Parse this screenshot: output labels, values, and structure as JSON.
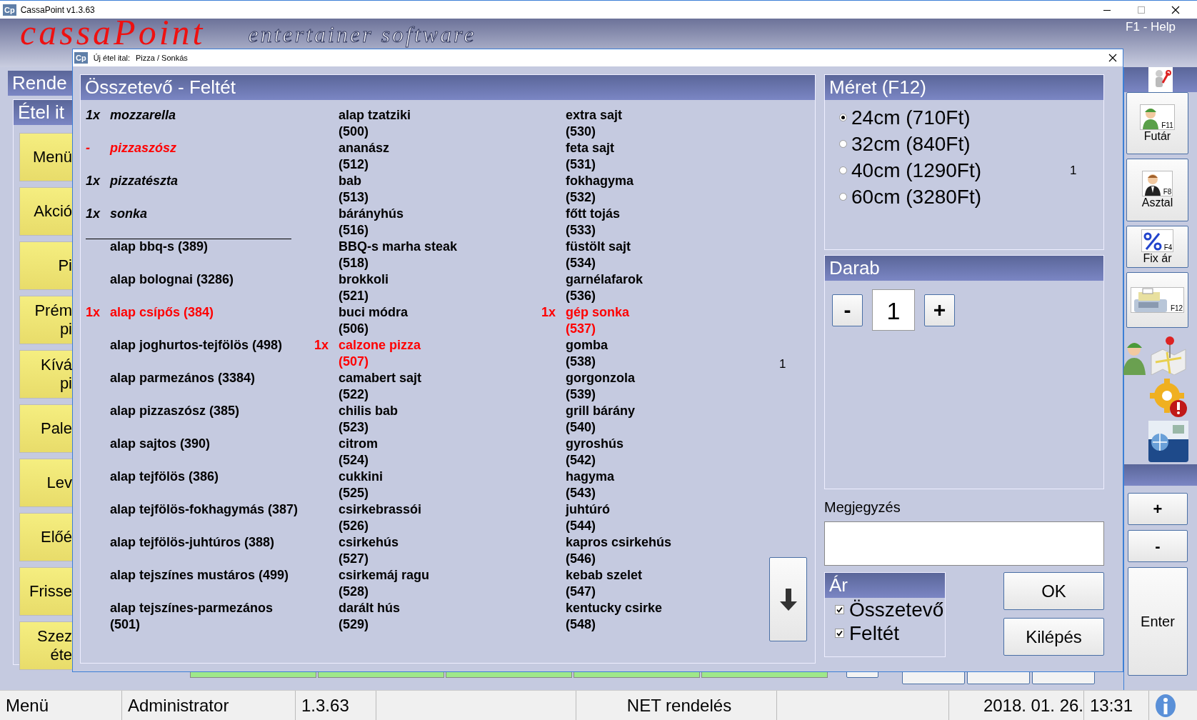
{
  "app_window": {
    "icon": "Cp",
    "title": "CassaPoint v1.3.63"
  },
  "banner": {
    "logo": "cassaPoint",
    "tagline": "entertainer software",
    "help": "F1 - Help"
  },
  "left_panel": {
    "title": "Rende",
    "subtitle": "Étel it",
    "categories": [
      "Menü",
      "Akció",
      "Pi",
      "Prém pi",
      "Kívá pi",
      "Pale",
      "Lev",
      "Előé",
      "Frisse",
      "Szez éte"
    ]
  },
  "side_toolbar": {
    "buttons": [
      {
        "kind": "courier",
        "label": "Futár",
        "key": "F11"
      },
      {
        "kind": "waiter",
        "label": "Asztal",
        "key": "F8"
      },
      {
        "kind": "percent",
        "label": "Fix ár",
        "key": "F4"
      },
      {
        "kind": "register",
        "key": "F12"
      }
    ],
    "keys": [
      "+",
      "-",
      "Enter"
    ]
  },
  "dialog": {
    "icon": "Cp",
    "title": "Új étel ital:",
    "item": "Pizza / Sonkás",
    "ingredients": {
      "title": "Összetevő - Feltét",
      "note": "1",
      "columns": [
        {
          "kind": "wide",
          "items": [
            {
              "kind": "base",
              "qty": "1x",
              "name": "mozzarella",
              "changed": false
            },
            {
              "kind": "base",
              "qty": "-",
              "name": "pizzaszósz",
              "changed": true
            },
            {
              "kind": "base",
              "qty": "1x",
              "name": "pizzatészta",
              "changed": false
            },
            {
              "kind": "base",
              "qty": "1x",
              "name": "sonka",
              "changed": false
            },
            {
              "kind": "topping",
              "name": "alap bbq-s",
              "code": "(389)",
              "changed": false
            },
            {
              "kind": "topping",
              "name": "alap bolognai",
              "code": "(3286)",
              "changed": false
            },
            {
              "kind": "topping",
              "qty": "1x",
              "name": "alap csípős",
              "code": "(384)",
              "changed": true
            },
            {
              "kind": "topping",
              "name": "alap joghurtos-tejfölös",
              "code": "(498)",
              "changed": false
            },
            {
              "kind": "topping",
              "name": "alap parmezános",
              "code": "(3384)",
              "changed": false
            },
            {
              "kind": "topping",
              "name": "alap pizzaszósz",
              "code": "(385)",
              "changed": false
            },
            {
              "kind": "topping",
              "name": "alap sajtos",
              "code": "(390)",
              "changed": false
            },
            {
              "kind": "topping",
              "name": "alap tejfölös",
              "code": "(386)",
              "changed": false
            },
            {
              "kind": "topping",
              "name": "alap tejfölös-fokhagymás",
              "code": "(387)",
              "changed": false
            },
            {
              "kind": "topping",
              "name": "alap tejfölös-juhtúros",
              "code": "(388)",
              "changed": false
            },
            {
              "kind": "topping",
              "name": "alap tejszínes mustáros",
              "code": "(499)",
              "changed": false
            },
            {
              "kind": "topping",
              "name": "alap tejszínes-parmezános",
              "code": "(501)",
              "changed": false
            }
          ]
        },
        {
          "kind": "narrow",
          "items": [
            {
              "kind": "topping",
              "name": "alap tzatziki",
              "code": "(500)",
              "changed": false
            },
            {
              "kind": "topping",
              "name": "ananász",
              "code": "(512)",
              "changed": false
            },
            {
              "kind": "topping",
              "name": "bab",
              "code": "(513)",
              "changed": false
            },
            {
              "kind": "topping",
              "name": "bárányhús",
              "code": "(516)",
              "changed": false
            },
            {
              "kind": "topping",
              "name": "BBQ-s marha steak",
              "code": "(518)",
              "changed": false
            },
            {
              "kind": "topping",
              "name": "brokkoli",
              "code": "(521)",
              "changed": false
            },
            {
              "kind": "topping",
              "name": "buci módra",
              "code": "(506)",
              "changed": false
            },
            {
              "kind": "topping",
              "qty": "1x",
              "name": "calzone pizza",
              "code": "(507)",
              "changed": true
            },
            {
              "kind": "topping",
              "name": "camabert sajt",
              "code": "(522)",
              "changed": false
            },
            {
              "kind": "topping",
              "name": "chilis bab",
              "code": "(523)",
              "changed": false
            },
            {
              "kind": "topping",
              "name": "citrom",
              "code": "(524)",
              "changed": false
            },
            {
              "kind": "topping",
              "name": "cukkini",
              "code": "(525)",
              "changed": false
            },
            {
              "kind": "topping",
              "name": "csirkebrassói",
              "code": "(526)",
              "changed": false
            },
            {
              "kind": "topping",
              "name": "csirkehús",
              "code": "(527)",
              "changed": false
            },
            {
              "kind": "topping",
              "name": "csirkemáj ragu",
              "code": "(528)",
              "changed": false
            },
            {
              "kind": "topping",
              "name": "darált hús",
              "code": "(529)",
              "changed": false
            }
          ]
        },
        {
          "kind": "narrow",
          "items": [
            {
              "kind": "topping",
              "name": "extra sajt",
              "code": "(530)",
              "changed": false
            },
            {
              "kind": "topping",
              "name": "feta sajt",
              "code": "(531)",
              "changed": false
            },
            {
              "kind": "topping",
              "name": "fokhagyma",
              "code": "(532)",
              "changed": false
            },
            {
              "kind": "topping",
              "name": "főtt tojás",
              "code": "(533)",
              "changed": false
            },
            {
              "kind": "topping",
              "name": "füstölt sajt",
              "code": "(534)",
              "changed": false
            },
            {
              "kind": "topping",
              "name": "garnélafarok",
              "code": "(536)",
              "changed": false
            },
            {
              "kind": "topping",
              "qty": "1x",
              "name": "gép sonka",
              "code": "(537)",
              "changed": true
            },
            {
              "kind": "topping",
              "name": "gomba",
              "code": "(538)",
              "changed": false
            },
            {
              "kind": "topping",
              "name": "gorgonzola",
              "code": "(539)",
              "changed": false
            },
            {
              "kind": "topping",
              "name": "grill bárány",
              "code": "(540)",
              "changed": false
            },
            {
              "kind": "topping",
              "name": "gyroshús",
              "code": "(542)",
              "changed": false
            },
            {
              "kind": "topping",
              "name": "hagyma",
              "code": "(543)",
              "changed": false
            },
            {
              "kind": "topping",
              "name": "juhtúró",
              "code": "(544)",
              "changed": false
            },
            {
              "kind": "topping",
              "name": "kapros csirkehús",
              "code": "(546)",
              "changed": false
            },
            {
              "kind": "topping",
              "name": "kebab szelet",
              "code": "(547)",
              "changed": false
            },
            {
              "kind": "topping",
              "name": "kentucky csirke",
              "code": "(548)",
              "changed": false
            }
          ]
        }
      ]
    },
    "size": {
      "title": "Méret (F12)",
      "options": [
        {
          "label": "24cm (710Ft)",
          "selected": true
        },
        {
          "label": "32cm (840Ft)",
          "selected": false
        },
        {
          "label": "40cm (1290Ft)",
          "selected": false,
          "count": "1"
        },
        {
          "label": "60cm (3280Ft)",
          "selected": false
        }
      ]
    },
    "quantity": {
      "title": "Darab",
      "minus": "-",
      "value": "1",
      "plus": "+"
    },
    "comment": {
      "label": "Megjegyzés"
    },
    "price": {
      "title": "Ár",
      "options": [
        {
          "label": "Összetevő",
          "checked": true
        },
        {
          "label": "Feltét",
          "checked": true
        }
      ]
    },
    "buttons": [
      "OK",
      "Kilépés"
    ]
  },
  "status_bar": {
    "menu": "Menü",
    "user": "Administrator",
    "version": "1.3.63",
    "mode": "NET rendelés",
    "date": "2018. 01. 26.",
    "time": "13:31"
  }
}
